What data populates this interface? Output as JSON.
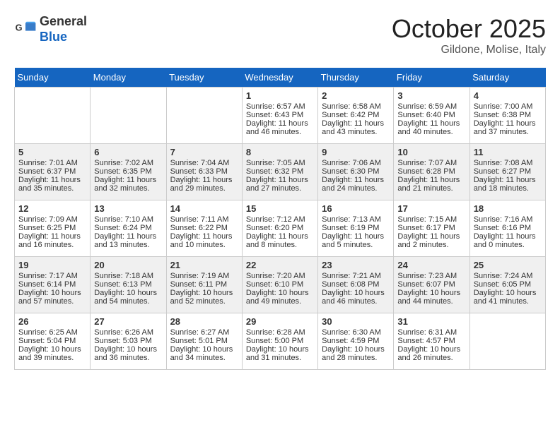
{
  "header": {
    "logo_line1": "General",
    "logo_line2": "Blue",
    "month": "October 2025",
    "location": "Gildone, Molise, Italy"
  },
  "weekdays": [
    "Sunday",
    "Monday",
    "Tuesday",
    "Wednesday",
    "Thursday",
    "Friday",
    "Saturday"
  ],
  "weeks": [
    [
      {
        "day": "",
        "text": ""
      },
      {
        "day": "",
        "text": ""
      },
      {
        "day": "",
        "text": ""
      },
      {
        "day": "1",
        "text": "Sunrise: 6:57 AM\nSunset: 6:43 PM\nDaylight: 11 hours and 46 minutes."
      },
      {
        "day": "2",
        "text": "Sunrise: 6:58 AM\nSunset: 6:42 PM\nDaylight: 11 hours and 43 minutes."
      },
      {
        "day": "3",
        "text": "Sunrise: 6:59 AM\nSunset: 6:40 PM\nDaylight: 11 hours and 40 minutes."
      },
      {
        "day": "4",
        "text": "Sunrise: 7:00 AM\nSunset: 6:38 PM\nDaylight: 11 hours and 37 minutes."
      }
    ],
    [
      {
        "day": "5",
        "text": "Sunrise: 7:01 AM\nSunset: 6:37 PM\nDaylight: 11 hours and 35 minutes."
      },
      {
        "day": "6",
        "text": "Sunrise: 7:02 AM\nSunset: 6:35 PM\nDaylight: 11 hours and 32 minutes."
      },
      {
        "day": "7",
        "text": "Sunrise: 7:04 AM\nSunset: 6:33 PM\nDaylight: 11 hours and 29 minutes."
      },
      {
        "day": "8",
        "text": "Sunrise: 7:05 AM\nSunset: 6:32 PM\nDaylight: 11 hours and 27 minutes."
      },
      {
        "day": "9",
        "text": "Sunrise: 7:06 AM\nSunset: 6:30 PM\nDaylight: 11 hours and 24 minutes."
      },
      {
        "day": "10",
        "text": "Sunrise: 7:07 AM\nSunset: 6:28 PM\nDaylight: 11 hours and 21 minutes."
      },
      {
        "day": "11",
        "text": "Sunrise: 7:08 AM\nSunset: 6:27 PM\nDaylight: 11 hours and 18 minutes."
      }
    ],
    [
      {
        "day": "12",
        "text": "Sunrise: 7:09 AM\nSunset: 6:25 PM\nDaylight: 11 hours and 16 minutes."
      },
      {
        "day": "13",
        "text": "Sunrise: 7:10 AM\nSunset: 6:24 PM\nDaylight: 11 hours and 13 minutes."
      },
      {
        "day": "14",
        "text": "Sunrise: 7:11 AM\nSunset: 6:22 PM\nDaylight: 11 hours and 10 minutes."
      },
      {
        "day": "15",
        "text": "Sunrise: 7:12 AM\nSunset: 6:20 PM\nDaylight: 11 hours and 8 minutes."
      },
      {
        "day": "16",
        "text": "Sunrise: 7:13 AM\nSunset: 6:19 PM\nDaylight: 11 hours and 5 minutes."
      },
      {
        "day": "17",
        "text": "Sunrise: 7:15 AM\nSunset: 6:17 PM\nDaylight: 11 hours and 2 minutes."
      },
      {
        "day": "18",
        "text": "Sunrise: 7:16 AM\nSunset: 6:16 PM\nDaylight: 11 hours and 0 minutes."
      }
    ],
    [
      {
        "day": "19",
        "text": "Sunrise: 7:17 AM\nSunset: 6:14 PM\nDaylight: 10 hours and 57 minutes."
      },
      {
        "day": "20",
        "text": "Sunrise: 7:18 AM\nSunset: 6:13 PM\nDaylight: 10 hours and 54 minutes."
      },
      {
        "day": "21",
        "text": "Sunrise: 7:19 AM\nSunset: 6:11 PM\nDaylight: 10 hours and 52 minutes."
      },
      {
        "day": "22",
        "text": "Sunrise: 7:20 AM\nSunset: 6:10 PM\nDaylight: 10 hours and 49 minutes."
      },
      {
        "day": "23",
        "text": "Sunrise: 7:21 AM\nSunset: 6:08 PM\nDaylight: 10 hours and 46 minutes."
      },
      {
        "day": "24",
        "text": "Sunrise: 7:23 AM\nSunset: 6:07 PM\nDaylight: 10 hours and 44 minutes."
      },
      {
        "day": "25",
        "text": "Sunrise: 7:24 AM\nSunset: 6:05 PM\nDaylight: 10 hours and 41 minutes."
      }
    ],
    [
      {
        "day": "26",
        "text": "Sunrise: 6:25 AM\nSunset: 5:04 PM\nDaylight: 10 hours and 39 minutes."
      },
      {
        "day": "27",
        "text": "Sunrise: 6:26 AM\nSunset: 5:03 PM\nDaylight: 10 hours and 36 minutes."
      },
      {
        "day": "28",
        "text": "Sunrise: 6:27 AM\nSunset: 5:01 PM\nDaylight: 10 hours and 34 minutes."
      },
      {
        "day": "29",
        "text": "Sunrise: 6:28 AM\nSunset: 5:00 PM\nDaylight: 10 hours and 31 minutes."
      },
      {
        "day": "30",
        "text": "Sunrise: 6:30 AM\nSunset: 4:59 PM\nDaylight: 10 hours and 28 minutes."
      },
      {
        "day": "31",
        "text": "Sunrise: 6:31 AM\nSunset: 4:57 PM\nDaylight: 10 hours and 26 minutes."
      },
      {
        "day": "",
        "text": ""
      }
    ]
  ]
}
